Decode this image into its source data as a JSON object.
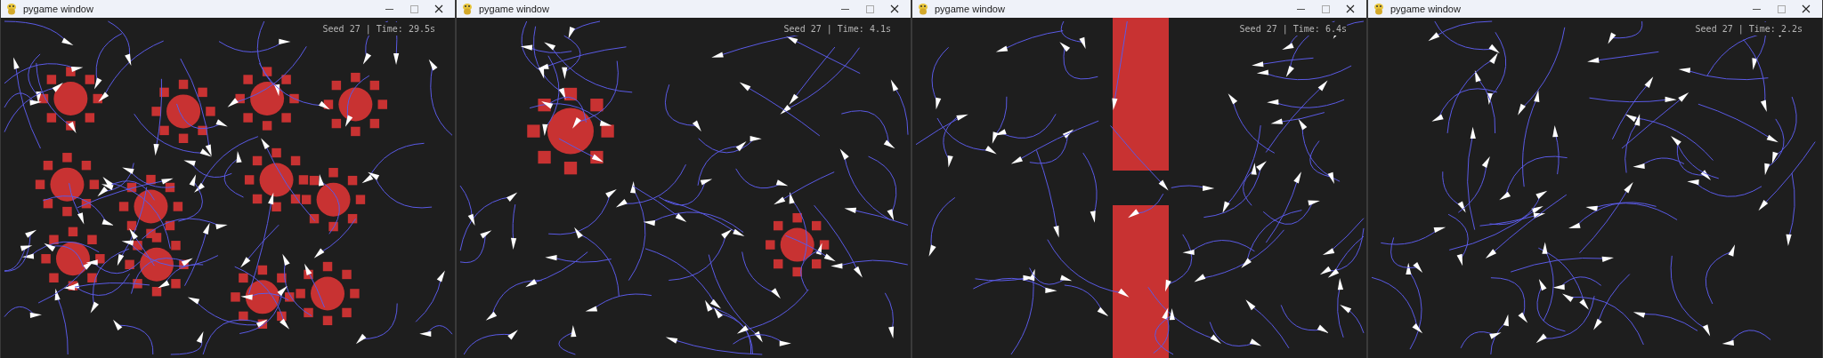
{
  "windows": [
    {
      "title": "pygame window",
      "status": "Seed 27 | Time: 29.5s"
    },
    {
      "title": "pygame window",
      "status": "Seed 27 | Time: 4.1s"
    },
    {
      "title": "pygame window",
      "status": "Seed 27 | Time: 6.4s"
    },
    {
      "title": "pygame window",
      "status": "Seed 27 | Time: 2.2s"
    }
  ]
}
